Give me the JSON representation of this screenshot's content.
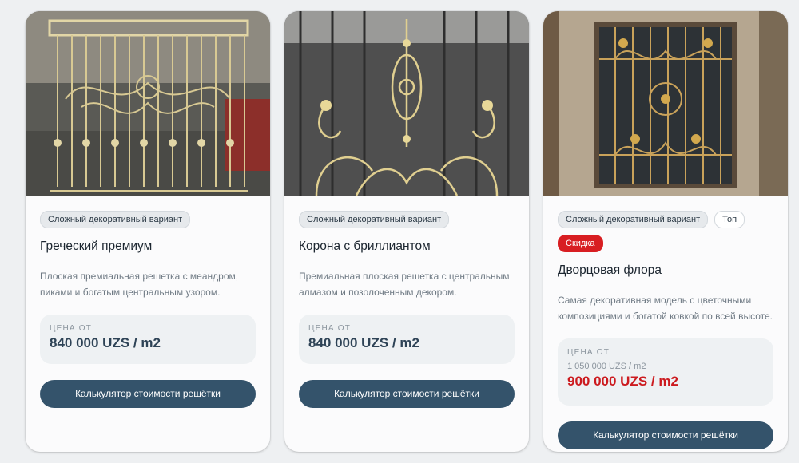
{
  "cards": [
    {
      "badges": [
        "Сложный декоративный вариант"
      ],
      "title": "Греческий премиум",
      "description": "Плоская премиальная решетка с меандром, пиками и богатым центральным узором.",
      "price_label": "ЦЕНА ОТ",
      "price": "840 000 UZS / m2",
      "button": "Калькулятор стоимости решётки"
    },
    {
      "badges": [
        "Сложный декоративный вариант"
      ],
      "title": "Корона с бриллиантом",
      "description": "Премиальная плоская решетка с центральным алмазом и позолоченным декором.",
      "price_label": "ЦЕНА ОТ",
      "price": "840 000 UZS / m2",
      "button": "Калькулятор стоимости решётки"
    },
    {
      "badges": [
        "Сложный декоративный вариант",
        "Топ",
        "Скидка"
      ],
      "title": "Дворцовая флора",
      "description": "Самая декоративная модель с цветочными композициями и богатой ковкой по всей высоте.",
      "price_label": "ЦЕНА ОТ",
      "old_price": "1 050 000 UZS / m2",
      "price": "900 000 UZS / m2",
      "button": "Калькулятор стоимости решётки"
    }
  ],
  "colors": {
    "button": "#34536b",
    "sale": "#d81e22",
    "price": "#2e4356"
  }
}
